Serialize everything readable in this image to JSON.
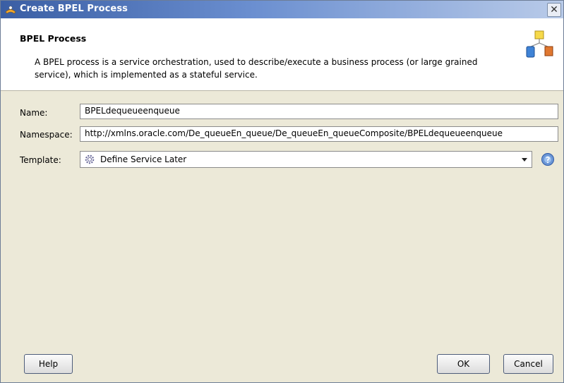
{
  "window": {
    "title": "Create BPEL Process",
    "close_label": "✕"
  },
  "header": {
    "title": "BPEL Process",
    "description": "A BPEL process is a service orchestration, used to describe/execute a business process (or large grained service), which is implemented as a stateful service."
  },
  "form": {
    "name_label": "Name:",
    "name_value": "BPELdequeueenqueue",
    "namespace_label": "Namespace:",
    "namespace_value": "http://xmlns.oracle.com/De_queueEn_queue/De_queueEn_queueComposite/BPELdequeueenqueue",
    "template_label": "Template:",
    "template_value": "Define Service Later",
    "template_icon": "gear-icon"
  },
  "buttons": {
    "help": "Help",
    "ok": "OK",
    "cancel": "Cancel"
  },
  "colors": {
    "title_bar_start": "#3a5ea4",
    "title_bar_end": "#b9cbe9",
    "dialog_bg": "#ece9d8",
    "header_bg": "#ffffff"
  }
}
